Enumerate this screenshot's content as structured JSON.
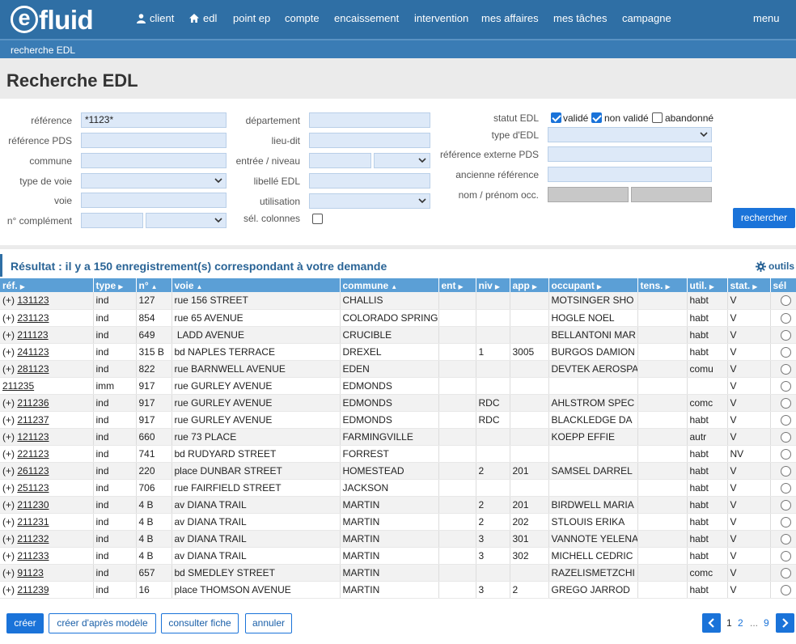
{
  "app": {
    "logo_letter": "e",
    "logo_text": "fluid"
  },
  "nav": {
    "client": "client",
    "edl": "edl",
    "point_ep": "point ep",
    "compte": "compte",
    "encaissement": "encaissement",
    "intervention": "intervention",
    "mes_affaires": "mes affaires",
    "mes_taches": "mes tâches",
    "campagne": "campagne",
    "menu": "menu"
  },
  "breadcrumb": "recherche EDL",
  "page_title": "Recherche EDL",
  "form": {
    "reference_label": "référence",
    "reference_value": "*1123*",
    "reference_pds_label": "référence PDS",
    "commune_label": "commune",
    "type_de_voie_label": "type de voie",
    "voie_label": "voie",
    "n_complement_label": "n° complément",
    "departement_label": "département",
    "lieu_dit_label": "lieu-dit",
    "entree_niveau_label": "entrée / niveau",
    "libelle_edl_label": "libellé EDL",
    "utilisation_label": "utilisation",
    "sel_colonnes_label": "sél. colonnes",
    "statut_edl_label": "statut EDL",
    "statut_valide": "validé",
    "statut_non_valide": "non validé",
    "statut_abandonne": "abandonné",
    "type_edl_label": "type d'EDL",
    "ref_externe_pds_label": "référence externe PDS",
    "ancienne_ref_label": "ancienne référence",
    "nom_prenom_occ_label": "nom / prénom occ.",
    "rechercher_label": "rechercher"
  },
  "result": {
    "title": "Résultat : il y a 150 enregistrement(s) correspondant à votre demande",
    "outils": "outils"
  },
  "table": {
    "headers": [
      "réf.",
      "type",
      "n°",
      "voie",
      "commune",
      "ent",
      "niv",
      "app",
      "occupant",
      "tens.",
      "util.",
      "stat.",
      "sél"
    ],
    "rows": [
      {
        "prefix": "(+) ",
        "ref": "131123",
        "type": "ind",
        "num": "127",
        "voie": "rue 156 STREET",
        "commune": "CHALLIS",
        "ent": "",
        "niv": "",
        "app": "",
        "occupant": "MOTSINGER SHO",
        "tens": "",
        "util": "habt",
        "stat": "V"
      },
      {
        "prefix": "(+) ",
        "ref": "231123",
        "type": "ind",
        "num": "854",
        "voie": "rue 65 AVENUE",
        "commune": "COLORADO SPRING",
        "ent": "",
        "niv": "",
        "app": "",
        "occupant": "HOGLE NOEL",
        "tens": "",
        "util": "habt",
        "stat": "V"
      },
      {
        "prefix": "(+) ",
        "ref": "211123",
        "type": "ind",
        "num": "649",
        "voie": " LADD AVENUE",
        "commune": "CRUCIBLE",
        "ent": "",
        "niv": "",
        "app": "",
        "occupant": "BELLANTONI MAR",
        "tens": "",
        "util": "habt",
        "stat": "V"
      },
      {
        "prefix": "(+) ",
        "ref": "241123",
        "type": "ind",
        "num": "315 B",
        "voie": "bd NAPLES TERRACE",
        "commune": "DREXEL",
        "ent": "",
        "niv": "1",
        "app": "3005",
        "occupant": "BURGOS DAMION",
        "tens": "",
        "util": "habt",
        "stat": "V"
      },
      {
        "prefix": "(+) ",
        "ref": "281123",
        "type": "ind",
        "num": "822",
        "voie": "rue BARNWELL AVENUE",
        "commune": "EDEN",
        "ent": "",
        "niv": "",
        "app": "",
        "occupant": "DEVTEK AEROSPA",
        "tens": "",
        "util": "comu",
        "stat": "V"
      },
      {
        "prefix": "",
        "ref": "211235",
        "type": "imm",
        "num": "917",
        "voie": "rue GURLEY AVENUE",
        "commune": "EDMONDS",
        "ent": "",
        "niv": "",
        "app": "",
        "occupant": "",
        "tens": "",
        "util": "",
        "stat": "V"
      },
      {
        "prefix": "(+) ",
        "ref": "211236",
        "type": "ind",
        "num": "917",
        "voie": "rue GURLEY AVENUE",
        "commune": "EDMONDS",
        "ent": "",
        "niv": "RDC",
        "app": "",
        "occupant": "AHLSTROM SPEC",
        "tens": "",
        "util": "comc",
        "stat": "V"
      },
      {
        "prefix": "(+) ",
        "ref": "211237",
        "type": "ind",
        "num": "917",
        "voie": "rue GURLEY AVENUE",
        "commune": "EDMONDS",
        "ent": "",
        "niv": "RDC",
        "app": "",
        "occupant": "BLACKLEDGE DA",
        "tens": "",
        "util": "habt",
        "stat": "V"
      },
      {
        "prefix": "(+) ",
        "ref": "121123",
        "type": "ind",
        "num": "660",
        "voie": "rue 73 PLACE",
        "commune": "FARMINGVILLE",
        "ent": "",
        "niv": "",
        "app": "",
        "occupant": "KOEPP EFFIE",
        "tens": "",
        "util": "autr",
        "stat": "V"
      },
      {
        "prefix": "(+) ",
        "ref": "221123",
        "type": "ind",
        "num": "741",
        "voie": "bd RUDYARD STREET",
        "commune": "FORREST",
        "ent": "",
        "niv": "",
        "app": "",
        "occupant": "",
        "tens": "",
        "util": "habt",
        "stat": "NV"
      },
      {
        "prefix": "(+) ",
        "ref": "261123",
        "type": "ind",
        "num": "220",
        "voie": "place DUNBAR STREET",
        "commune": "HOMESTEAD",
        "ent": "",
        "niv": "2",
        "app": "201",
        "occupant": "SAMSEL DARREL",
        "tens": "",
        "util": "habt",
        "stat": "V"
      },
      {
        "prefix": "(+) ",
        "ref": "251123",
        "type": "ind",
        "num": "706",
        "voie": "rue FAIRFIELD STREET",
        "commune": "JACKSON",
        "ent": "",
        "niv": "",
        "app": "",
        "occupant": "",
        "tens": "",
        "util": "habt",
        "stat": "V"
      },
      {
        "prefix": "(+) ",
        "ref": "211230",
        "type": "ind",
        "num": "4 B",
        "voie": "av DIANA TRAIL",
        "commune": "MARTIN",
        "ent": "",
        "niv": "2",
        "app": "201",
        "occupant": "BIRDWELL MARIA",
        "tens": "",
        "util": "habt",
        "stat": "V"
      },
      {
        "prefix": "(+) ",
        "ref": "211231",
        "type": "ind",
        "num": "4 B",
        "voie": "av DIANA TRAIL",
        "commune": "MARTIN",
        "ent": "",
        "niv": "2",
        "app": "202",
        "occupant": "STLOUIS ERIKA",
        "tens": "",
        "util": "habt",
        "stat": "V"
      },
      {
        "prefix": "(+) ",
        "ref": "211232",
        "type": "ind",
        "num": "4 B",
        "voie": "av DIANA TRAIL",
        "commune": "MARTIN",
        "ent": "",
        "niv": "3",
        "app": "301",
        "occupant": "VANNOTE YELENA",
        "tens": "",
        "util": "habt",
        "stat": "V"
      },
      {
        "prefix": "(+) ",
        "ref": "211233",
        "type": "ind",
        "num": "4 B",
        "voie": "av DIANA TRAIL",
        "commune": "MARTIN",
        "ent": "",
        "niv": "3",
        "app": "302",
        "occupant": "MICHELL CEDRIC",
        "tens": "",
        "util": "habt",
        "stat": "V"
      },
      {
        "prefix": "(+) ",
        "ref": "91123",
        "type": "ind",
        "num": "657",
        "voie": "bd SMEDLEY STREET",
        "commune": "MARTIN",
        "ent": "",
        "niv": "",
        "app": "",
        "occupant": "RAZELISMETZCHI",
        "tens": "",
        "util": "comc",
        "stat": "V"
      },
      {
        "prefix": "(+) ",
        "ref": "211239",
        "type": "ind",
        "num": "16",
        "voie": "place THOMSON AVENUE",
        "commune": "MARTIN",
        "ent": "",
        "niv": "3",
        "app": "2",
        "occupant": "GREGO JARROD",
        "tens": "",
        "util": "habt",
        "stat": "V"
      }
    ]
  },
  "footer": {
    "creer": "créer",
    "creer_modele": "créer d'après modèle",
    "consulter_fiche": "consulter fiche",
    "annuler": "annuler"
  },
  "pagination": {
    "current": "1",
    "next": "2",
    "ellipsis": "...",
    "last": "9"
  },
  "colors": {
    "topbar": "#2f6fa5",
    "accent": "#1a73d9",
    "table_header": "#5b9fd6",
    "input_bg": "#dde9f8"
  }
}
